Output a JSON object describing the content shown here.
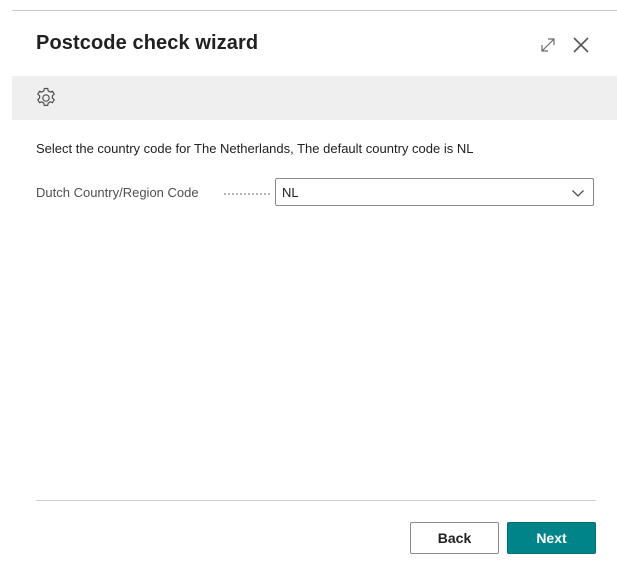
{
  "dialog": {
    "title": "Postcode check wizard",
    "icons": {
      "expand": "expand-icon",
      "close": "close-icon",
      "settings": "gear-icon",
      "dropdown": "chevron-down-icon"
    }
  },
  "content": {
    "instruction": "Select the country code for The Netherlands, The default country code is NL",
    "field": {
      "label": "Dutch Country/Region Code",
      "value": "NL"
    }
  },
  "footer": {
    "back_label": "Back",
    "next_label": "Next"
  },
  "colors": {
    "primary_button": "#008489",
    "actionbar": "#efefef"
  }
}
